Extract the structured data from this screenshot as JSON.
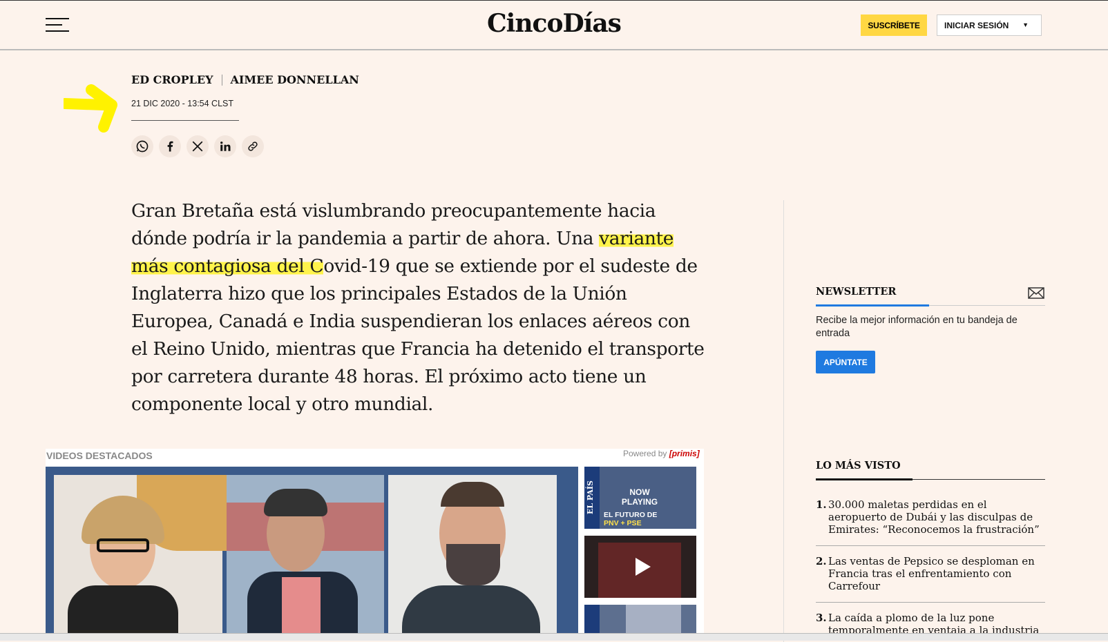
{
  "header": {
    "logo": "CincoDías",
    "subscribe_label": "SUSCRÍBETE",
    "login_label": "INICIAR SESIÓN"
  },
  "article": {
    "authors": [
      "ED CROPLEY",
      "AIMEE DONNELLAN"
    ],
    "date": "21 DIC 2020 - 13:54 CLST",
    "lead_part1": "Gran Bretaña está vislumbrando preocupantemente hacia dónde podría ir la pandemia a partir de ahora. Una ",
    "lead_highlight": "variante más contagiosa del C",
    "lead_part2": "ovid-19 que se extiende por el sudeste de Inglaterra hizo que los principales Estados de la Unión Europea, Canadá e India suspendieran los enlaces aéreos con el Reino Unido, mientras que Francia ha detenido el transporte por carretera durante 48 horas. El próximo acto tiene un componente local y otro mundial."
  },
  "share": {
    "icons": [
      "whatsapp-icon",
      "facebook-icon",
      "x-icon",
      "linkedin-icon",
      "link-icon"
    ]
  },
  "videos": {
    "title": "VIDEOS DESTACADOS",
    "powered_by": "Powered by",
    "powered_brand": "primis",
    "now_playing": "NOW PLAYING",
    "thumb1_caption_top": "EL FUTURO DE",
    "thumb1_caption_bottom": "PNV + PSE",
    "brand_vertical": "EL PAÍS"
  },
  "newsletter": {
    "title": "NEWSLETTER",
    "text": "Recibe la mejor información en tu bandeja de entrada",
    "button": "APÚNTATE"
  },
  "most_viewed": {
    "title": "LO MÁS VISTO",
    "items": [
      {
        "num": "1.",
        "text": "30.000 maletas perdidas en el aeropuerto de Dubái y las disculpas de Emirates: “Reconocemos la frustración”"
      },
      {
        "num": "2.",
        "text": "Las ventas de Pepsico se desploman en Francia tras el enfrentamiento con Carrefour"
      },
      {
        "num": "3.",
        "text": "La caída a plomo de la luz pone temporalmente en ventaja a la industria"
      }
    ]
  },
  "colors": {
    "background": "#fdf3ec",
    "accent_yellow": "#ffd743",
    "highlight_yellow": "#fff34b",
    "accent_blue": "#1f7ae0"
  }
}
